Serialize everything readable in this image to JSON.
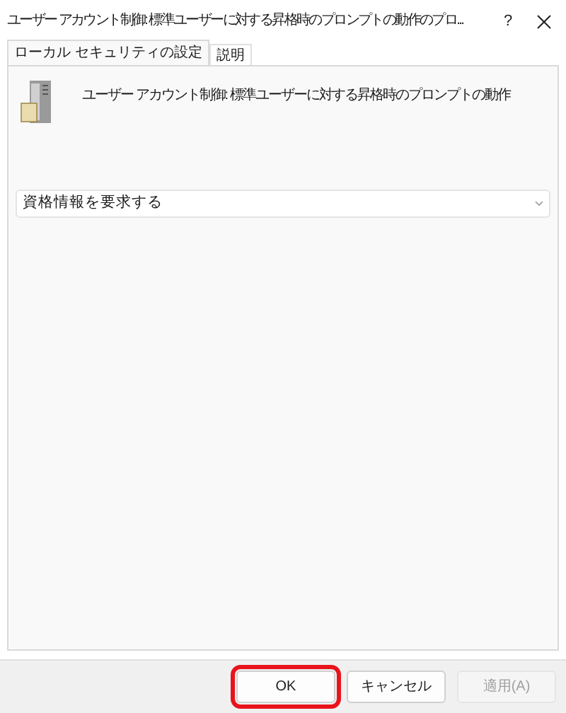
{
  "window": {
    "title": "ユーザー アカウント制御: 標準ユーザーに対する昇格時のプロンプトの動作のプロ...",
    "help": "?"
  },
  "tabs": [
    {
      "label": "ローカル セキュリティの設定",
      "selected": true
    },
    {
      "label": "説明",
      "selected": false
    }
  ],
  "policy": {
    "name": "ユーザー アカウント制御: 標準ユーザーに対する昇格時のプロンプトの動作"
  },
  "setting": {
    "value": "資格情報を要求する"
  },
  "buttons": [
    {
      "label": "OK",
      "disabled": false,
      "highlighted": true
    },
    {
      "label": "キャンセル",
      "disabled": false,
      "highlighted": false
    },
    {
      "label": "適用(A)",
      "disabled": true,
      "highlighted": false
    }
  ]
}
